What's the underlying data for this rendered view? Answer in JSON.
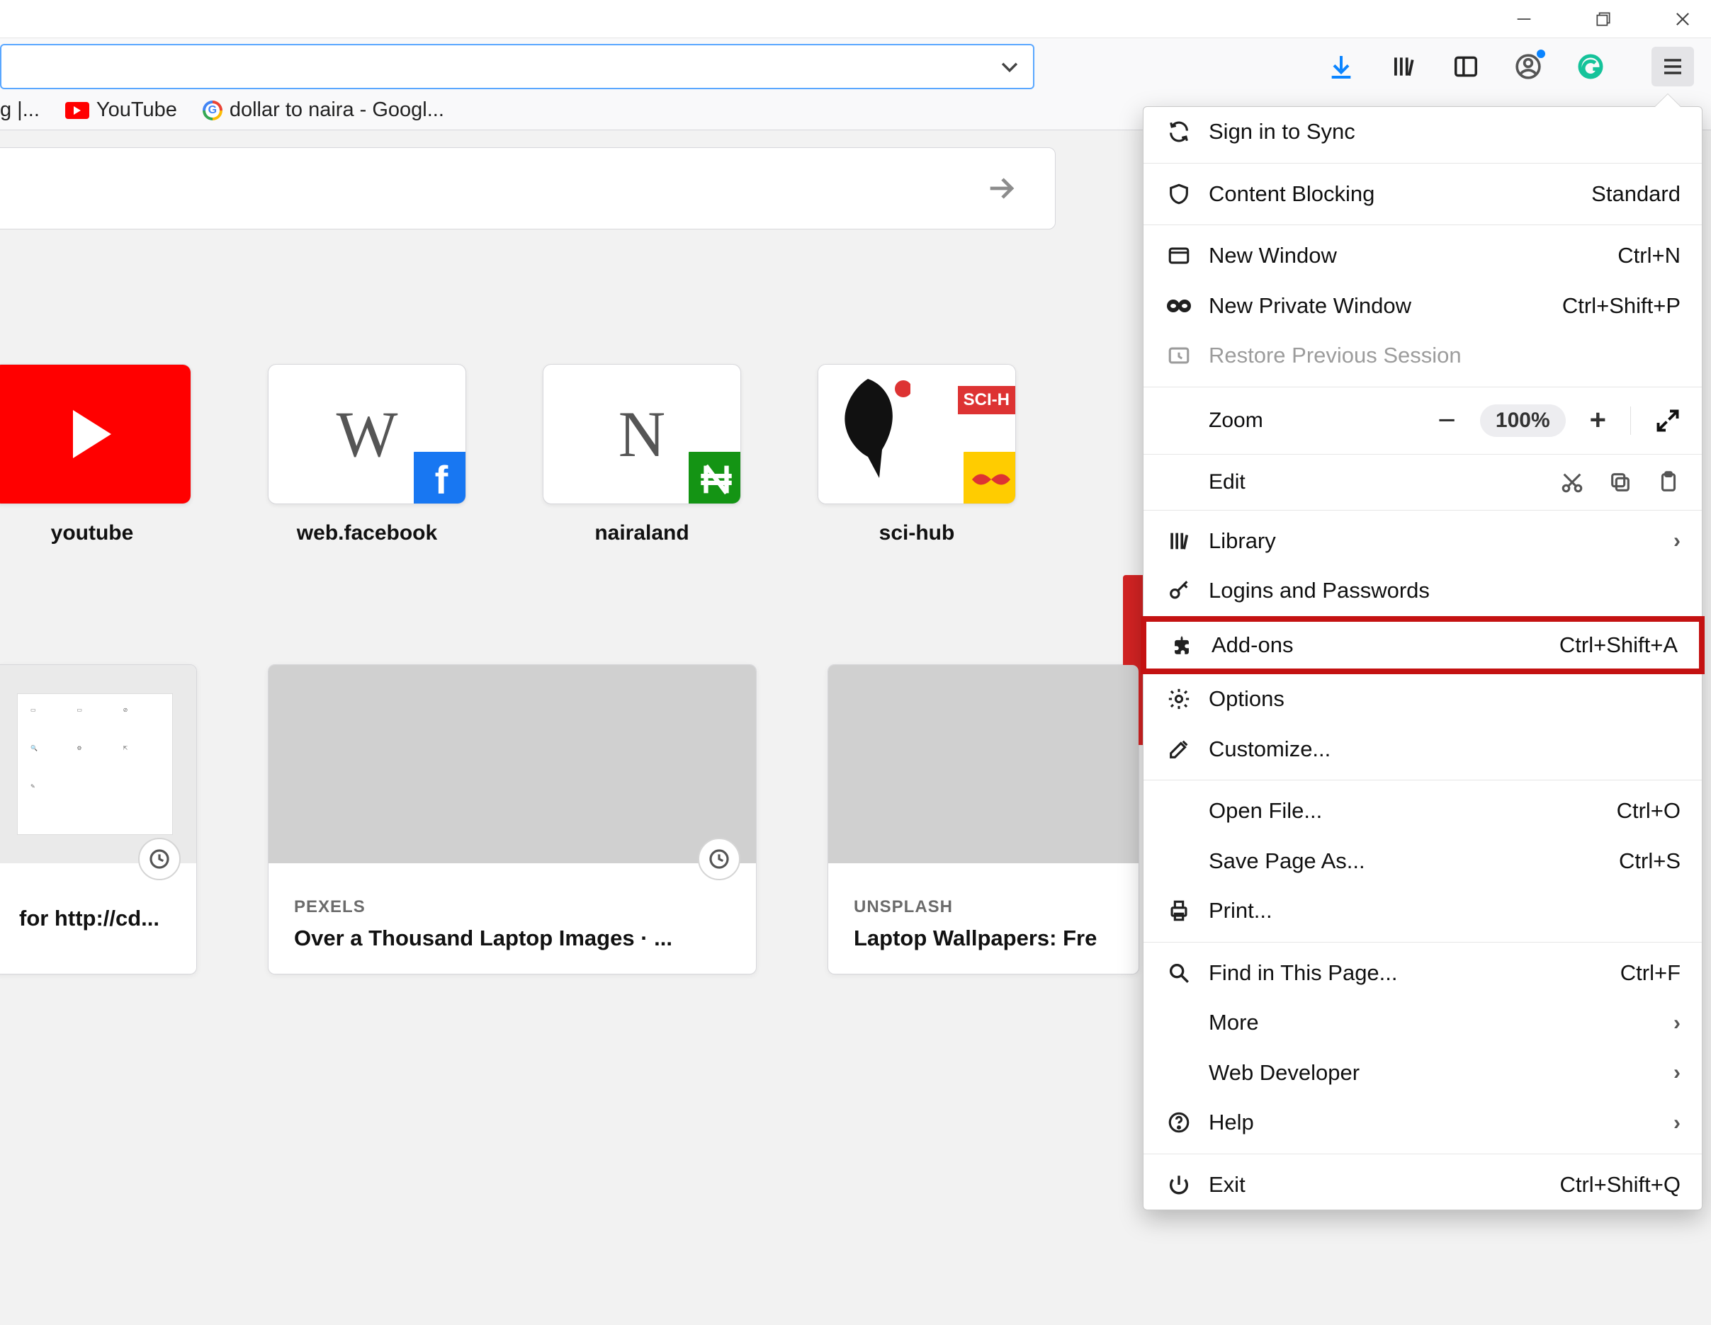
{
  "toolbar_icons": {
    "dropdown": "⌄"
  },
  "bookmarks": {
    "truncated": "g |...",
    "youtube": "YouTube",
    "google": "dollar to naira - Googl..."
  },
  "topsites": {
    "s1": "youtube",
    "s2_letter": "W",
    "s2": "web.facebook",
    "s3_letter": "N",
    "s3": "nairaland",
    "s4": "sci-hub"
  },
  "highlights": {
    "c1_title": "for http://cd...",
    "c2_kicker": "PEXELS",
    "c2_title": "Over a Thousand Laptop Images · ...",
    "c3_kicker": "UNSPLASH",
    "c3_title": "Laptop Wallpapers: Fre"
  },
  "menu": {
    "sign_in": "Sign in to Sync",
    "content_blocking": "Content Blocking",
    "content_blocking_state": "Standard",
    "new_window": "New Window",
    "new_window_sc": "Ctrl+N",
    "new_private": "New Private Window",
    "new_private_sc": "Ctrl+Shift+P",
    "restore": "Restore Previous Session",
    "zoom_label": "Zoom",
    "zoom_pct": "100%",
    "edit_label": "Edit",
    "library": "Library",
    "logins": "Logins and Passwords",
    "addons": "Add-ons",
    "addons_sc": "Ctrl+Shift+A",
    "options": "Options",
    "customize": "Customize...",
    "open_file": "Open File...",
    "open_file_sc": "Ctrl+O",
    "save_page": "Save Page As...",
    "save_page_sc": "Ctrl+S",
    "print": "Print...",
    "find": "Find in This Page...",
    "find_sc": "Ctrl+F",
    "more": "More",
    "web_dev": "Web Developer",
    "help": "Help",
    "exit": "Exit",
    "exit_sc": "Ctrl+Shift+Q"
  }
}
